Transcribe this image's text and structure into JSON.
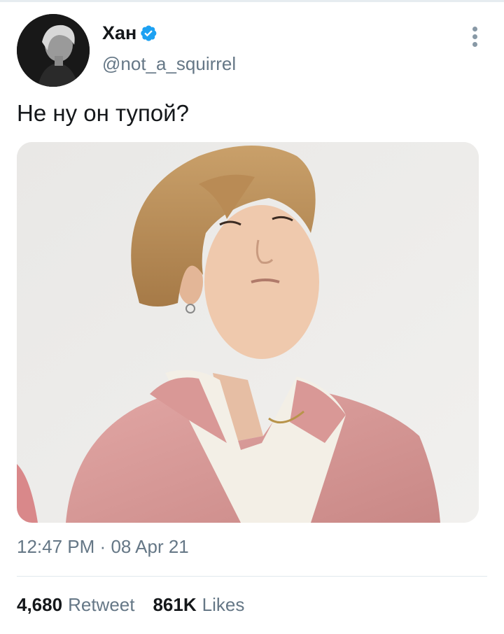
{
  "tweet": {
    "author": {
      "display_name": "Хан",
      "handle": "@not_a_squirrel",
      "verified": true,
      "verified_color": "#1da1f2"
    },
    "text": "Не ну он тупой?",
    "time": "12:47 PM",
    "separator": "·",
    "date": "08 Apr 21",
    "stats": {
      "retweets_count": "4,680",
      "retweets_label": "Retweet",
      "likes_count": "861K",
      "likes_label": "Likes"
    }
  },
  "icons": {
    "verified": "verified-badge-icon",
    "more": "more-vertical-icon"
  }
}
